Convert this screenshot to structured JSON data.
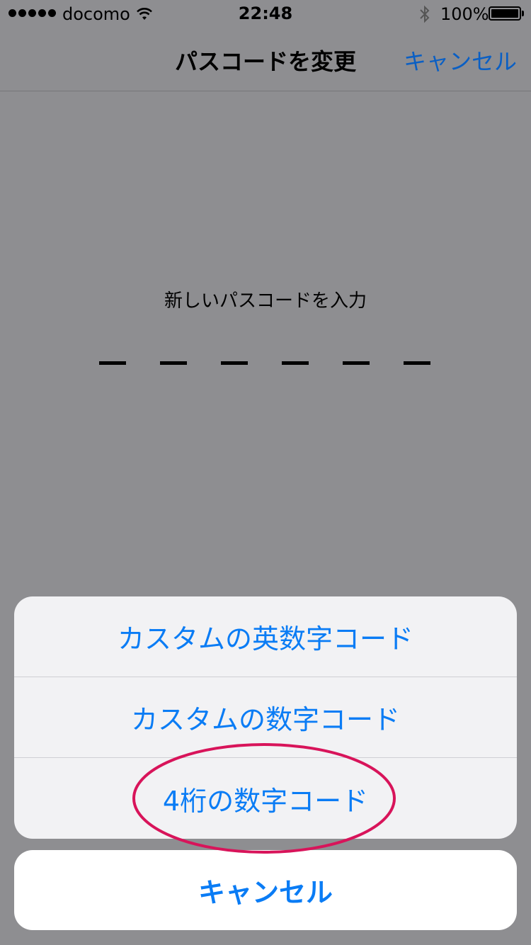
{
  "status_bar": {
    "carrier": "docomo",
    "time": "22:48",
    "battery_percent": "100%",
    "signal_bars": 5,
    "icons": [
      "signal-dots-icon",
      "wifi-icon",
      "bluetooth-icon",
      "battery-icon"
    ]
  },
  "nav": {
    "title": "パスコードを変更",
    "cancel_label": "キャンセル"
  },
  "passcode": {
    "prompt": "新しいパスコードを入力",
    "digit_count": 6
  },
  "action_sheet": {
    "options": [
      {
        "label": "カスタムの英数字コード"
      },
      {
        "label": "カスタムの数字コード"
      },
      {
        "label": "4桁の数字コード"
      }
    ],
    "cancel_label": "キャンセル"
  },
  "annotation": {
    "highlight_color": "#d8145a",
    "highlighted_option_index": 2
  },
  "colors": {
    "accent": "#0a7cf5",
    "dimmed_background": "#8e8e91"
  }
}
